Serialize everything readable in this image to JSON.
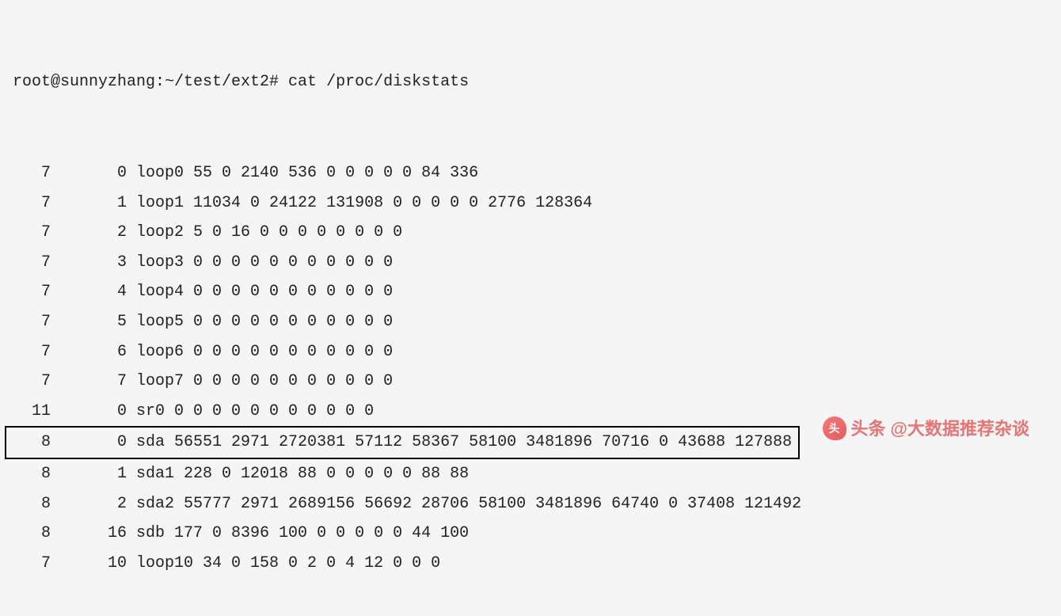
{
  "prompt": "root@sunnyzhang:~/test/ext2# cat /proc/diskstats",
  "rows": [
    {
      "major": 7,
      "minor": 0,
      "device": "loop0",
      "stats": "55 0 2140 536 0 0 0 0 0 84 336"
    },
    {
      "major": 7,
      "minor": 1,
      "device": "loop1",
      "stats": "11034 0 24122 131908 0 0 0 0 0 2776 128364"
    },
    {
      "major": 7,
      "minor": 2,
      "device": "loop2",
      "stats": "5 0 16 0 0 0 0 0 0 0 0"
    },
    {
      "major": 7,
      "minor": 3,
      "device": "loop3",
      "stats": "0 0 0 0 0 0 0 0 0 0 0"
    },
    {
      "major": 7,
      "minor": 4,
      "device": "loop4",
      "stats": "0 0 0 0 0 0 0 0 0 0 0"
    },
    {
      "major": 7,
      "minor": 5,
      "device": "loop5",
      "stats": "0 0 0 0 0 0 0 0 0 0 0"
    },
    {
      "major": 7,
      "minor": 6,
      "device": "loop6",
      "stats": "0 0 0 0 0 0 0 0 0 0 0"
    },
    {
      "major": 7,
      "minor": 7,
      "device": "loop7",
      "stats": "0 0 0 0 0 0 0 0 0 0 0"
    },
    {
      "major": 11,
      "minor": 0,
      "device": "sr0",
      "stats": "0 0 0 0 0 0 0 0 0 0 0"
    },
    {
      "major": 8,
      "minor": 0,
      "device": "sda",
      "stats": "56551 2971 2720381 57112 58367 58100 3481896 70716 0 43688 127888",
      "highlighted": true
    },
    {
      "major": 8,
      "minor": 1,
      "device": "sda1",
      "stats": "228 0 12018 88 0 0 0 0 0 88 88"
    },
    {
      "major": 8,
      "minor": 2,
      "device": "sda2",
      "stats": "55777 2971 2689156 56692 28706 58100 3481896 64740 0 37408 121492"
    },
    {
      "major": 8,
      "minor": 16,
      "device": "sdb",
      "stats": "177 0 8396 100 0 0 0 0 0 44 100"
    },
    {
      "major": 7,
      "minor": 10,
      "device": "loop10",
      "stats": "34 0 158 0 2 0 4 12 0 0 0"
    }
  ],
  "watermark": {
    "label": "头条",
    "handle": "@大数据推荐杂谈"
  }
}
